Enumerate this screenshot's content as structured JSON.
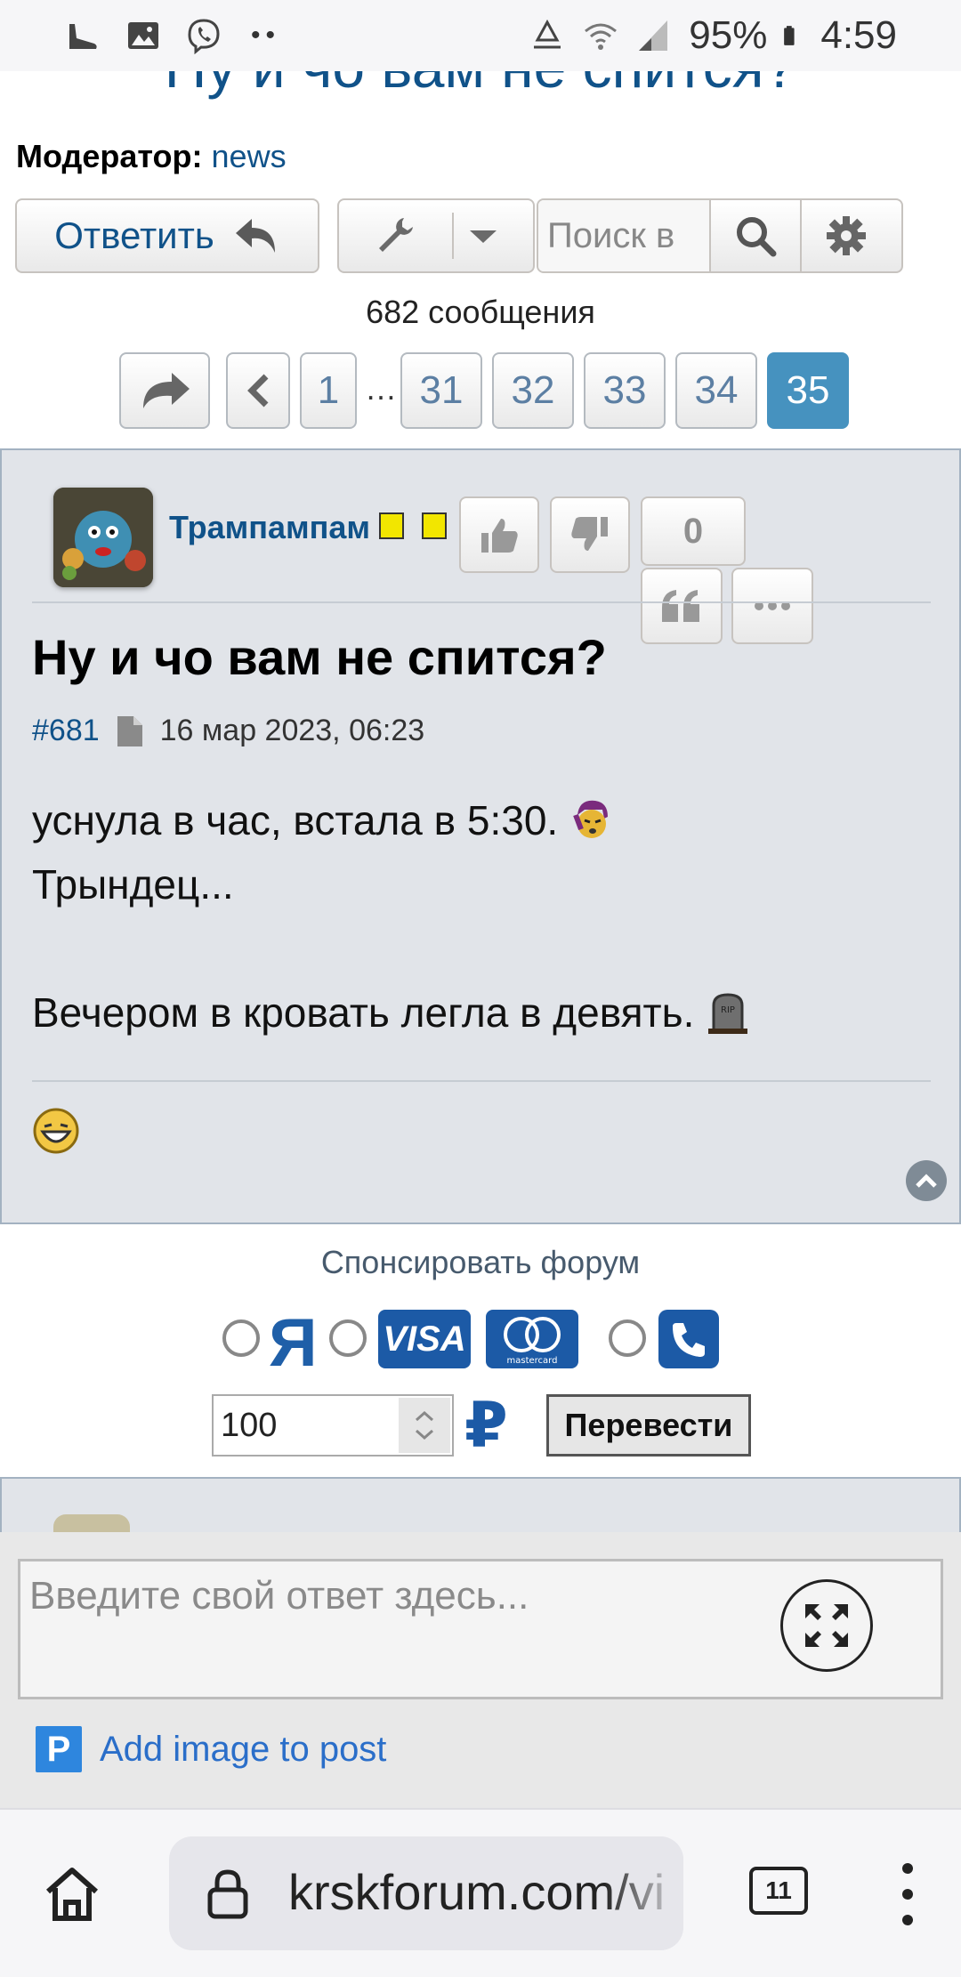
{
  "status_bar": {
    "battery": "95%",
    "time": "4:59",
    "left_icons": [
      "sneaker-icon",
      "gallery-icon",
      "viber-icon"
    ],
    "right_icons": [
      "recycle-icon",
      "wifi-icon",
      "signal-icon",
      "battery-icon"
    ]
  },
  "thread": {
    "title": "Ну и чо вам не спится?",
    "moderator_label": "Модератор:",
    "moderator_name": "news"
  },
  "toolbar": {
    "reply_label": "Ответить",
    "search_placeholder": "Поиск в"
  },
  "post_count": "682 сообщения",
  "pagination": {
    "pages": [
      "1",
      "31",
      "32",
      "33",
      "34",
      "35"
    ],
    "ellipsis": "…",
    "active": "35"
  },
  "post": {
    "author": "Трампампам",
    "rating_count": "0",
    "subject": "Ну и чо вам не спится?",
    "number": "#681",
    "datetime": "16 мар 2023, 06:23",
    "body": {
      "line1": "уснула в час, встала в 5:30.",
      "line2": "Трындец...",
      "line3": "Вечером в кровать легла в девять."
    }
  },
  "sponsor": {
    "title": "Спонсировать форум",
    "yandex_label": "Я",
    "visa_label": "VISA",
    "mastercard_label": "mastercard",
    "amount": "100",
    "currency": "₽",
    "transfer_label": "Перевести"
  },
  "quick_reply": {
    "placeholder": "Введите свой ответ здесь...",
    "add_image_label": "Add image to post",
    "p_label": "P"
  },
  "browser": {
    "url": "krskforum.com/vi",
    "tab_count": "11"
  },
  "colors": {
    "link_blue": "#105289",
    "active_page": "#4692bf",
    "post_bg": "#e1e4e9",
    "payment_blue": "#1c5aa6"
  }
}
